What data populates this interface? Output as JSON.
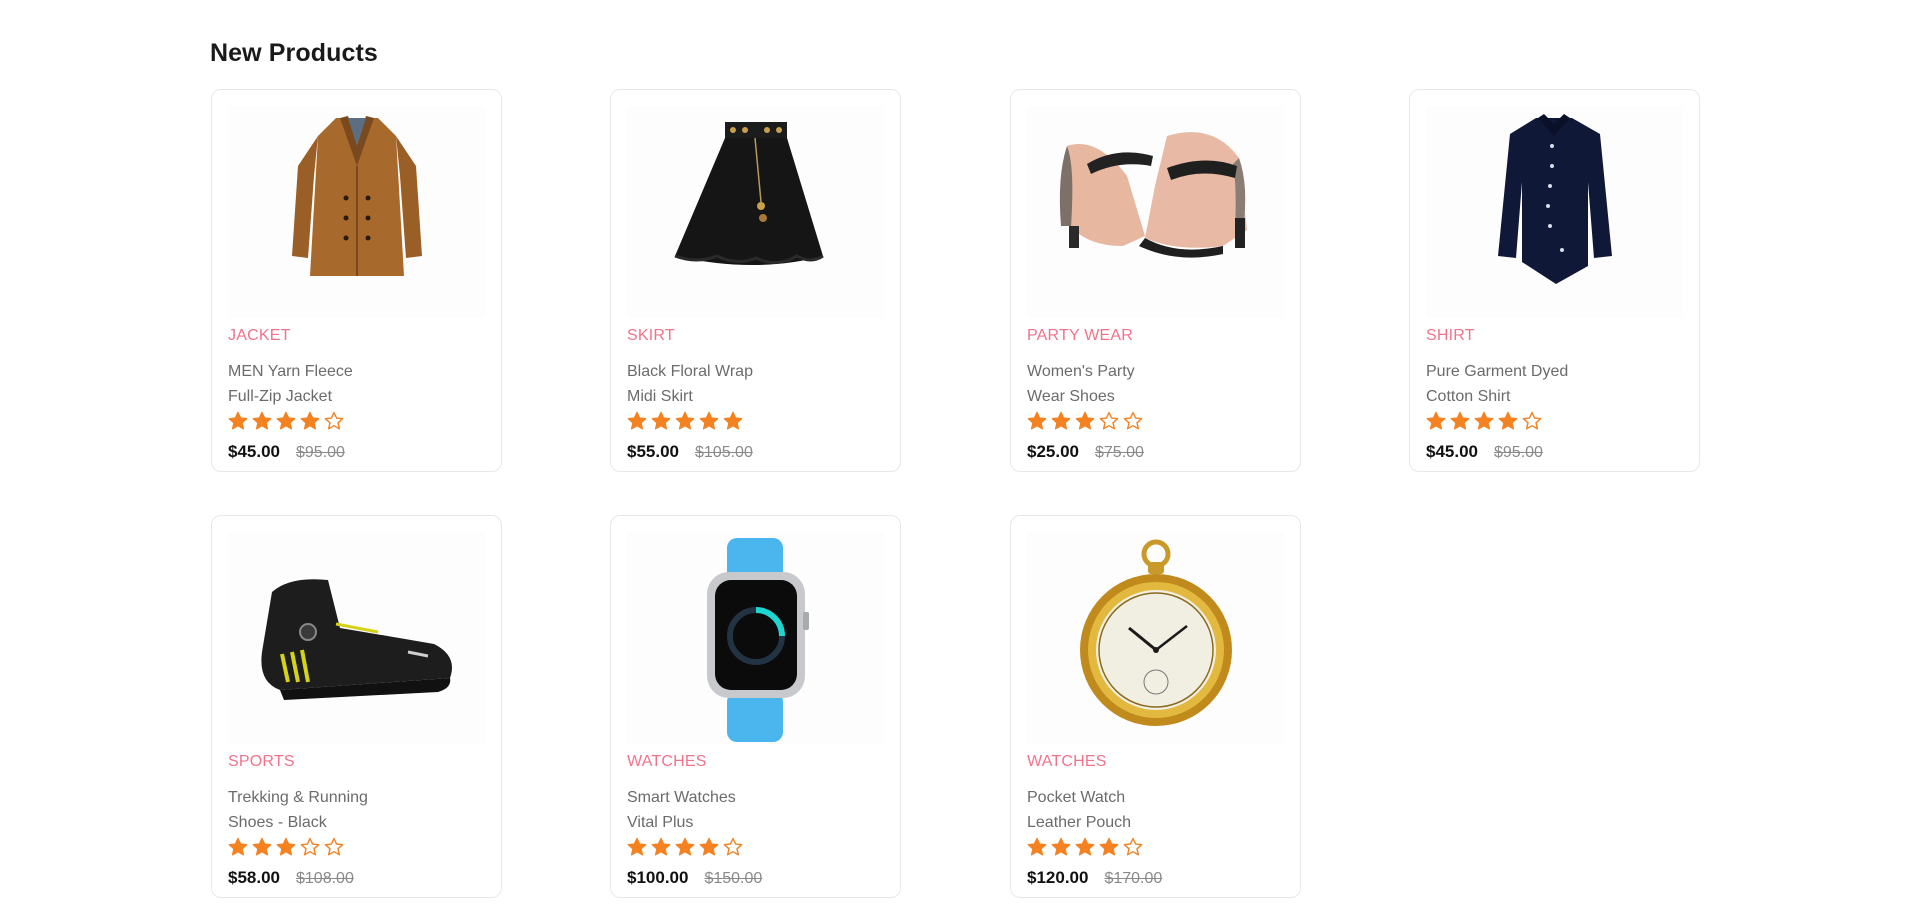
{
  "section_title": "New Products",
  "colors": {
    "accent": "#f0738a",
    "star": "#f58220"
  },
  "products": [
    {
      "category": "JACKET",
      "title": "MEN Yarn Fleece\nFull-Zip Jacket",
      "rating": 4,
      "price": "$45.00",
      "old_price": "$95.00",
      "image": "brown-coat-image"
    },
    {
      "category": "SKIRT",
      "title": "Black Floral Wrap\nMidi Skirt",
      "rating": 5,
      "price": "$55.00",
      "old_price": "$105.00",
      "image": "black-skirt-image"
    },
    {
      "category": "PARTY WEAR",
      "title": "Women's Party\nWear Shoes",
      "rating": 3,
      "price": "$25.00",
      "old_price": "$75.00",
      "image": "heels-image"
    },
    {
      "category": "SHIRT",
      "title": "Pure Garment Dyed\nCotton Shirt",
      "rating": 4,
      "price": "$45.00",
      "old_price": "$95.00",
      "image": "navy-shirt-image"
    },
    {
      "category": "SPORTS",
      "title": "Trekking & Running\nShoes - Black",
      "rating": 3,
      "price": "$58.00",
      "old_price": "$108.00",
      "image": "sports-shoe-image"
    },
    {
      "category": "WATCHES",
      "title": "Smart Watches\nVital Plus",
      "rating": 4,
      "price": "$100.00",
      "old_price": "$150.00",
      "image": "smartwatch-image"
    },
    {
      "category": "WATCHES",
      "title": "Pocket Watch\nLeather Pouch",
      "rating": 4,
      "price": "$120.00",
      "old_price": "$170.00",
      "image": "pocket-watch-image"
    }
  ]
}
